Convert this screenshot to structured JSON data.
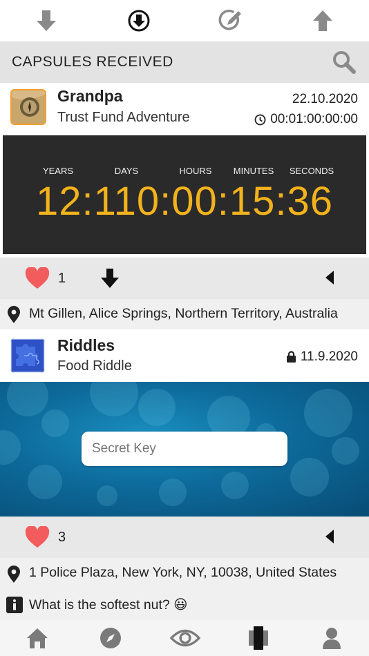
{
  "header": {
    "title": "CAPSULES RECEIVED"
  },
  "capsules": [
    {
      "sender": "Grandpa",
      "subject": "Trust Fund Adventure",
      "date": "22.10.2020",
      "remaining": "00:01:00:00:00",
      "timer": {
        "labels": [
          "YEARS",
          "DAYS",
          "HOURS",
          "MINUTES",
          "SECONDS"
        ],
        "value": "12:110:00:15:36"
      },
      "likes": "1",
      "location": "Mt Gillen, Alice Springs, Northern Territory, Australia"
    },
    {
      "sender": "Riddles",
      "subject": "Food Riddle",
      "date": "11.9.2020",
      "secret_placeholder": "Secret Key",
      "likes": "3",
      "location": "1 Police Plaza, New York, NY, 10038, United States",
      "info": "What is the softest nut? 😃"
    }
  ],
  "icons": {
    "top": [
      "download-arrow-icon",
      "download-circle-icon",
      "edit-icon",
      "upload-arrow-icon"
    ],
    "bottom": [
      "home-icon",
      "compass-icon",
      "eye-icon",
      "capsule-icon",
      "profile-icon"
    ]
  },
  "colors": {
    "timer_digits": "#f2b21c",
    "heart": "#f25c5c",
    "header_bg": "#e3e3e3"
  }
}
